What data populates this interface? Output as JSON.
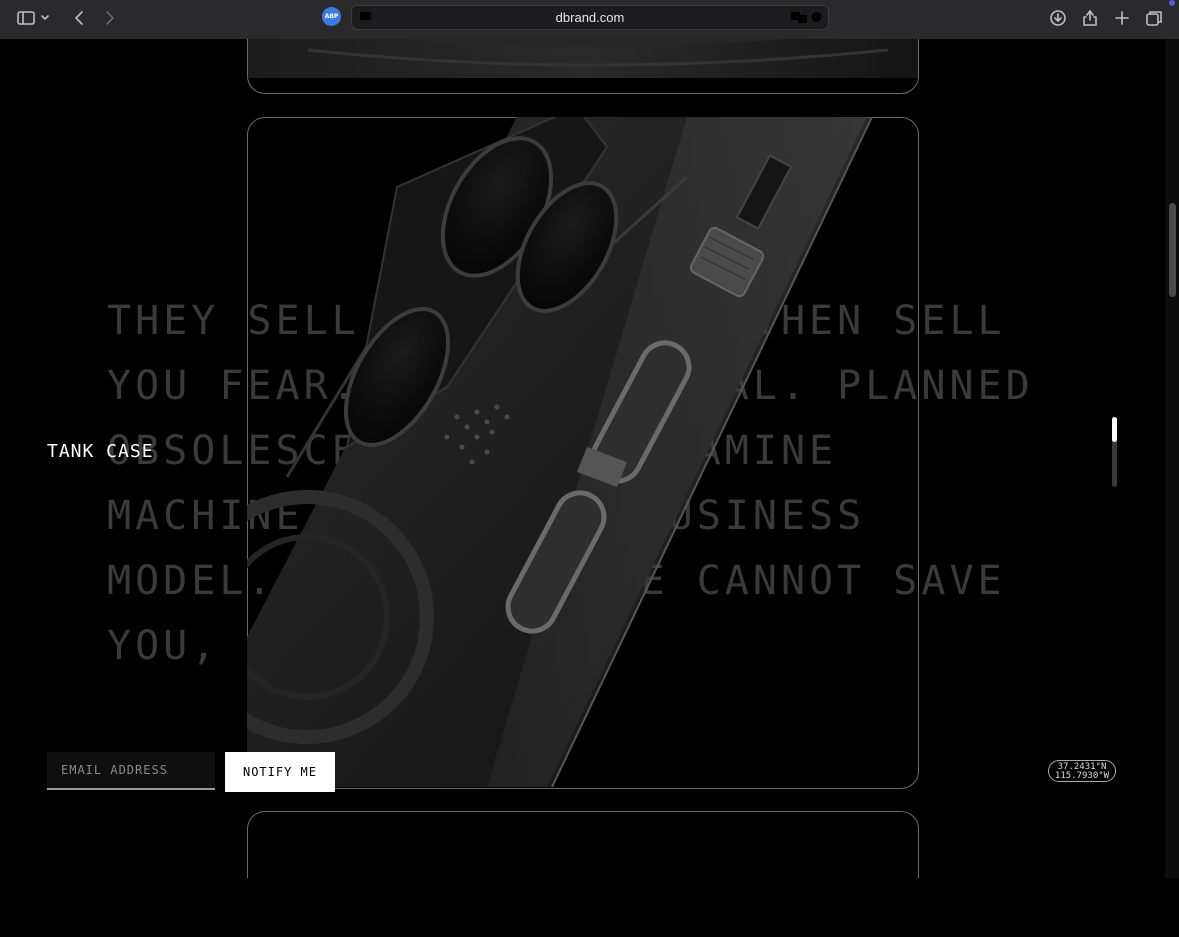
{
  "browser": {
    "url": "dbrand.com",
    "abp_label": "ABP",
    "icons": [
      "sidebar-icon",
      "chevron-down-icon",
      "back-icon",
      "forward-icon",
      "adblock-icon",
      "tab-overview-icon",
      "translate-icon",
      "reload-icon",
      "download-icon",
      "share-icon",
      "new-tab-icon",
      "tabs-icon"
    ]
  },
  "page": {
    "manifesto": "THEY SELL YOU A PHONE, THEN SELL\nYOU FEAR. PLANNED DENIAL. PLANNED\nOBSOLESCENCE. THE DOPAMINE\nMACHINE IS NOT THE BUSINESS\nMODEL. A RUGGED CASE CANNOT SAVE\nYOU, NOTHING CAN.",
    "product_title": "TANK CASE",
    "signup": {
      "email_placeholder": "EMAIL ADDRESS",
      "notify_label": "NOTIFY ME"
    },
    "coords": {
      "lat": "37.2431°N",
      "lon": "115.7930°W"
    },
    "progress": 0.36
  }
}
